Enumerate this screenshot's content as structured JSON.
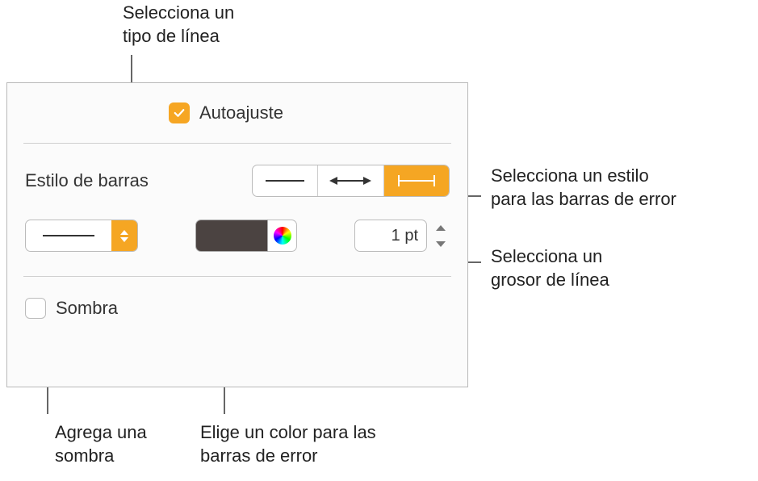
{
  "callouts": {
    "line_type": "Selecciona un\ntipo de línea",
    "style": "Selecciona un estilo\npara las barras de error",
    "thickness": "Selecciona un\ngrosor de línea",
    "shadow": "Agrega una\nsombra",
    "color": "Elige un color para las\nbarras de error"
  },
  "panel": {
    "autofit": {
      "label": "Autoajuste",
      "checked": true
    },
    "bar_style_label": "Estilo de barras",
    "bar_style_selected_index": 2,
    "line_type": {
      "value": "solid"
    },
    "line_color": "#4b4341",
    "line_weight": {
      "value": "1 pt"
    },
    "shadow": {
      "label": "Sombra",
      "checked": false
    }
  }
}
